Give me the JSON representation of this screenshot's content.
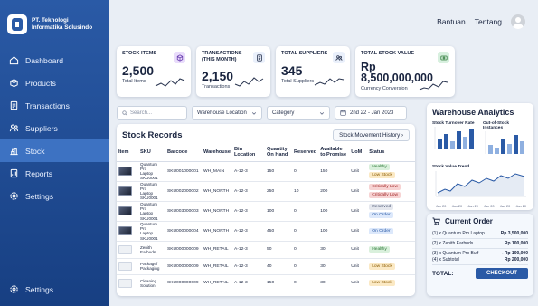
{
  "brand": {
    "name_line1": "PT. Teknologi",
    "name_line2": "Informatika Solusindo"
  },
  "nav": [
    {
      "label": "Dashboard",
      "icon": "home-icon"
    },
    {
      "label": "Products",
      "icon": "box-icon"
    },
    {
      "label": "Transactions",
      "icon": "receipt-icon"
    },
    {
      "label": "Suppliers",
      "icon": "users-icon"
    },
    {
      "label": "Stock",
      "icon": "stock-icon",
      "active": true
    },
    {
      "label": "Reports",
      "icon": "report-icon"
    },
    {
      "label": "Settings",
      "icon": "gear-icon"
    }
  ],
  "nav_bottom": {
    "label": "Settings"
  },
  "topbar": {
    "help": "Bantuan",
    "about": "Tentang"
  },
  "stats": [
    {
      "title": "STOCK ITEMS",
      "value": "2,500",
      "sub": "Total Items",
      "icon": "cube-icon",
      "accent": "#e9dcfb"
    },
    {
      "title": "TRANSACTIONS (THIS MONTH)",
      "value": "2,150",
      "sub": "Transactions",
      "icon": "document-icon",
      "accent": "#eaf0fb"
    },
    {
      "title": "TOTAL SUPPLIERS",
      "value": "345",
      "sub": "Total Suppliers",
      "icon": "users-icon",
      "accent": "#eaf0fb"
    },
    {
      "title": "TOTAL STOCK VALUE",
      "value": "Rp 8,500,000,000",
      "sub": "Currency Conversion",
      "icon": "money-icon",
      "accent": "#d8f0df"
    }
  ],
  "filters": {
    "search_placeholder": "Search...",
    "location": "Warehouse Location",
    "category": "Category",
    "date_range": "2nd 22 - Jan 2023"
  },
  "records": {
    "title": "Stock Records",
    "history_button": "Stock Movement History",
    "columns": [
      "Item",
      "SKU",
      "Barcode",
      "Warehouse",
      "Bin Location",
      "Quantity On Hand",
      "Reserved",
      "Available to Promise",
      "UoM",
      "Status"
    ],
    "rows": [
      {
        "thumb": "dark",
        "sku": [
          "Quantum Pro",
          "Laptop",
          "SKU0001"
        ],
        "barcode": "SKU001000001",
        "warehouse": "WH_MAIN",
        "bin": "A-12-3",
        "qty": "150",
        "reserved": "0",
        "atp": "150",
        "uom": "Unit",
        "status": [
          "Healthy",
          "Low Stock"
        ],
        "status_class": [
          "b-healthy",
          "b-low"
        ]
      },
      {
        "thumb": "dark",
        "sku": [
          "Quantum Pro",
          "Laptop",
          "SKU0001"
        ],
        "barcode": "SKU002000002",
        "warehouse": "WH_NORTH",
        "bin": "A-12-3",
        "qty": "250",
        "reserved": "10",
        "atp": "200",
        "uom": "Unit",
        "status": [
          "Critically Low",
          "Critically Low"
        ],
        "status_class": [
          "b-crit",
          "b-crit"
        ]
      },
      {
        "thumb": "dark",
        "sku": [
          "Quantum Pro",
          "Laptop",
          "SKU0001"
        ],
        "barcode": "SKU003000003",
        "warehouse": "WH_NORTH",
        "bin": "A-12-3",
        "qty": "100",
        "reserved": "0",
        "atp": "100",
        "uom": "Unit",
        "status": [
          "Reserved",
          "On Order"
        ],
        "status_class": [
          "b-res",
          "b-ord"
        ]
      },
      {
        "thumb": "dark",
        "sku": [
          "Quantum Pro",
          "Laptop",
          "SKU0001"
        ],
        "barcode": "SKU000000004",
        "warehouse": "WH_NORTH",
        "bin": "A-12-3",
        "qty": "450",
        "reserved": "0",
        "atp": "100",
        "uom": "Unit",
        "status": [
          "On Order"
        ],
        "status_class": [
          "b-ord"
        ]
      },
      {
        "thumb": "light",
        "sku": [
          "Zenith",
          "Earbuds"
        ],
        "barcode": "SKU000000009",
        "warehouse": "WH_RETAIL",
        "bin": "A-12-3",
        "qty": "50",
        "reserved": "0",
        "atp": "30",
        "uom": "Unit",
        "status": [
          "Healthy"
        ],
        "status_class": [
          "b-healthy"
        ]
      },
      {
        "thumb": "light",
        "sku": [
          "Packagef",
          "Packaging"
        ],
        "barcode": "SKU000000009",
        "warehouse": "WH_RETAIL",
        "bin": "A-12-3",
        "qty": "40",
        "reserved": "0",
        "atp": "30",
        "uom": "Unit",
        "status": [
          "Low Stock"
        ],
        "status_class": [
          "b-low"
        ]
      },
      {
        "thumb": "light",
        "sku": [
          "Cleaning",
          "Solution"
        ],
        "barcode": "SKU000000009",
        "warehouse": "WH_RETAIL",
        "bin": "A-12-3",
        "qty": "150",
        "reserved": "0",
        "atp": "30",
        "uom": "Unit",
        "status": [
          "Low Stock"
        ],
        "status_class": [
          "b-low"
        ]
      }
    ]
  },
  "analytics": {
    "title": "Warehouse Analytics",
    "turnover_label": "Stock Turnover Rate",
    "outofstock_label": "Out-of-Stock Instances",
    "trend_label": "Stock Value Trend",
    "trend_ticks": [
      "Jan 20",
      "Jan 20",
      "Jan 20",
      "Jan 20",
      "Jan 20",
      "Jan 20"
    ]
  },
  "order": {
    "title": "Current Order",
    "lines": [
      {
        "label": "(1) x Quantum Pro Laptop",
        "amount": "Rp 3,500,000"
      },
      {
        "label": "(2) x Zenith Earbuds",
        "amount": "Rp 100,000"
      },
      {
        "label": "(3) x Quantum Pro Buff\n(4) x Subtotal",
        "amount": "- Rp 100,000\nRp 200,000"
      }
    ],
    "total_label": "TOTAL:",
    "checkout": "CHECKOUT"
  }
}
